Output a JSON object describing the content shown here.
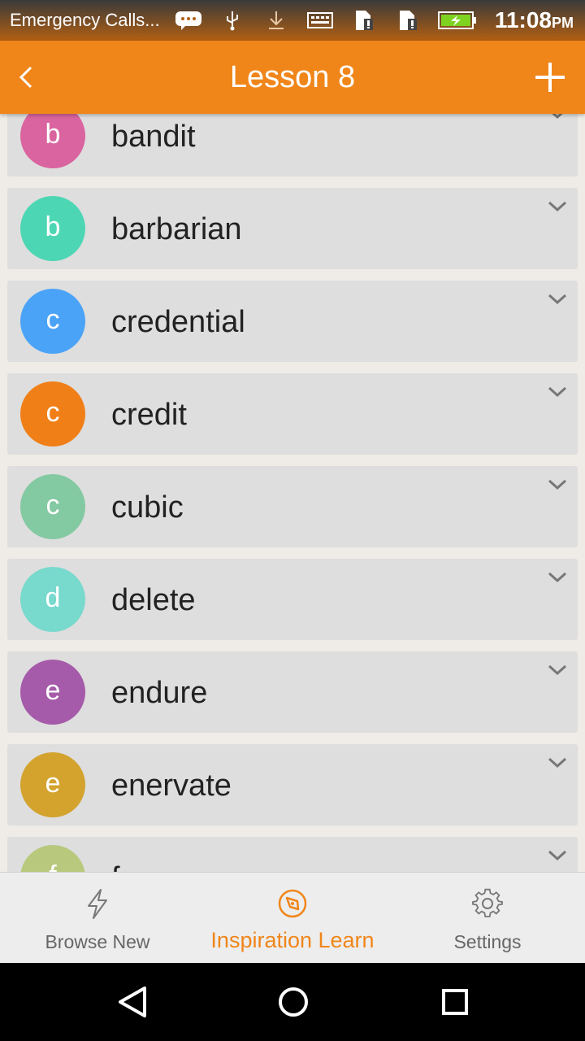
{
  "status_bar": {
    "carrier": "Emergency Calls...",
    "time": "11:08",
    "ampm": "PM",
    "icons": [
      "chat-bubble-icon",
      "usb-icon",
      "download-icon",
      "keyboard-icon",
      "sim-card-icon",
      "sim-card-icon",
      "battery-charging-icon"
    ]
  },
  "app_bar": {
    "title": "Lesson 8",
    "back_icon": "chevron-left-icon",
    "add_icon": "plus-icon"
  },
  "words": [
    {
      "letter": "b",
      "word": "bandit",
      "color": "#d9649f"
    },
    {
      "letter": "b",
      "word": "barbarian",
      "color": "#4dd6b4"
    },
    {
      "letter": "c",
      "word": "credential",
      "color": "#4aa3f7"
    },
    {
      "letter": "c",
      "word": "credit",
      "color": "#f07f17"
    },
    {
      "letter": "c",
      "word": "cubic",
      "color": "#83c9a1"
    },
    {
      "letter": "d",
      "word": "delete",
      "color": "#78d9cd"
    },
    {
      "letter": "e",
      "word": "endure",
      "color": "#a55ba9"
    },
    {
      "letter": "e",
      "word": "enervate",
      "color": "#d3a32e"
    },
    {
      "letter": "f",
      "word": "f",
      "color": "#b8c97e"
    }
  ],
  "bottom_nav": [
    {
      "label": "Browse New",
      "icon": "lightning-icon",
      "active": false
    },
    {
      "label": "Inspiration Learn",
      "icon": "compass-icon",
      "active": true
    },
    {
      "label": "Settings",
      "icon": "gear-icon",
      "active": false
    }
  ],
  "colors": {
    "accent": "#f0861a",
    "card": "#dedede",
    "background": "#efebe6"
  }
}
